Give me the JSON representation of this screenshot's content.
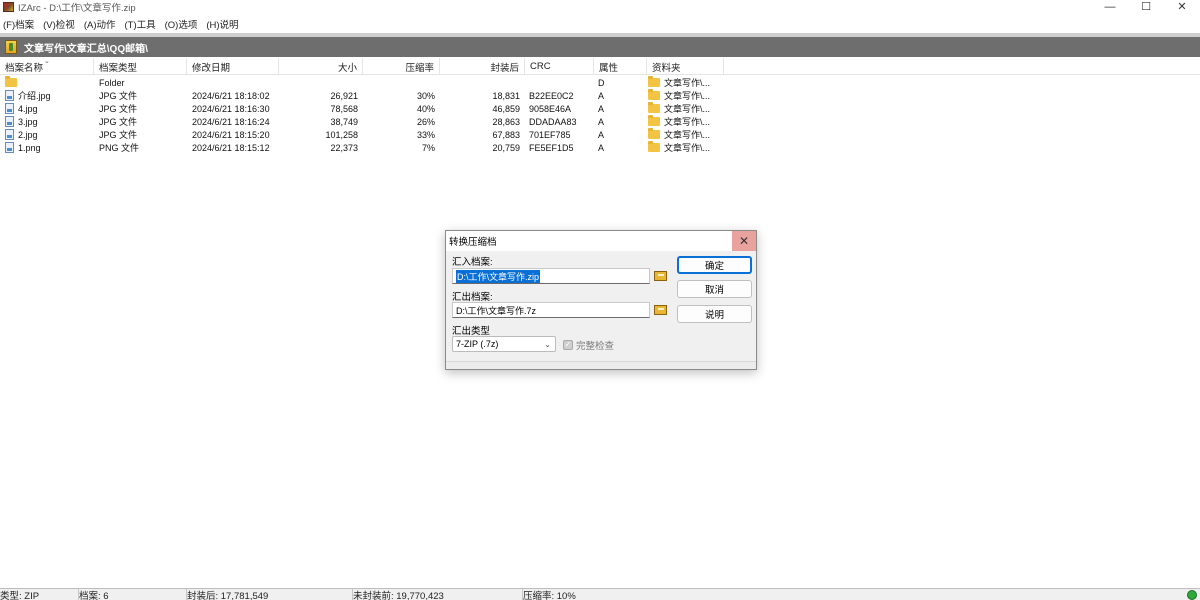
{
  "window": {
    "title": "IZArc - D:\\工作\\文章写作.zip",
    "minimize": "—",
    "maximize": "☐",
    "close": "✕"
  },
  "menu": [
    "(F)档案",
    "(V)检视",
    "(A)动作",
    "(T)工具",
    "(O)选项",
    "(H)说明"
  ],
  "path": "文章写作\\文章汇总\\QQ邮箱\\",
  "columns": {
    "name": "档案名称",
    "type": "档案类型",
    "modified": "修改日期",
    "size": "大小",
    "ratio": "压缩率",
    "packed": "封装后",
    "crc": "CRC",
    "attr": "属性",
    "folder": "资料夹"
  },
  "rows": [
    {
      "icon": "folder-icon",
      "name": "",
      "type": "Folder",
      "modified": "",
      "size": "",
      "ratio": "",
      "packed": "",
      "crc": "",
      "attr": "D",
      "folder": "文章写作\\..."
    },
    {
      "icon": "image-file-icon",
      "name": "介绍.jpg",
      "type": "JPG 文件",
      "modified": "2024/6/21 18:18:02",
      "size": "26,921",
      "ratio": "30%",
      "packed": "18,831",
      "crc": "B22EE0C2",
      "attr": "A",
      "folder": "文章写作\\..."
    },
    {
      "icon": "image-file-icon",
      "name": "4.jpg",
      "type": "JPG 文件",
      "modified": "2024/6/21 18:16:30",
      "size": "78,568",
      "ratio": "40%",
      "packed": "46,859",
      "crc": "9058E46A",
      "attr": "A",
      "folder": "文章写作\\..."
    },
    {
      "icon": "image-file-icon",
      "name": "3.jpg",
      "type": "JPG 文件",
      "modified": "2024/6/21 18:16:24",
      "size": "38,749",
      "ratio": "26%",
      "packed": "28,863",
      "crc": "DDADAA83",
      "attr": "A",
      "folder": "文章写作\\..."
    },
    {
      "icon": "image-file-icon",
      "name": "2.jpg",
      "type": "JPG 文件",
      "modified": "2024/6/21 18:15:20",
      "size": "101,258",
      "ratio": "33%",
      "packed": "67,883",
      "crc": "701EF785",
      "attr": "A",
      "folder": "文章写作\\..."
    },
    {
      "icon": "image-file-icon",
      "name": "1.png",
      "type": "PNG 文件",
      "modified": "2024/6/21 18:15:12",
      "size": "22,373",
      "ratio": "7%",
      "packed": "20,759",
      "crc": "FE5EF1D5",
      "attr": "A",
      "folder": "文章写作\\..."
    }
  ],
  "dialog": {
    "title": "转换压缩档",
    "input_label": "汇入档案:",
    "input_value": "D:\\工作\\文章写作.zip",
    "output_label": "汇出档案:",
    "output_value": "D:\\工作\\文章写作.7z",
    "type_label": "汇出类型",
    "type_value": "7-ZIP (.7z)",
    "check_label": "完整检查",
    "ok": "确定",
    "cancel": "取消",
    "help": "说明",
    "close": "✕"
  },
  "status": {
    "type": "类型: ZIP",
    "files": "档案: 6",
    "packed": "封装后: 17,781,549",
    "unpacked": "未封装前: 19,770,423",
    "ratio": "压缩率: 10%"
  },
  "colors": {
    "path_bar": "#6e6e6e",
    "selection": "#0a6fd6",
    "status_led": "#2fa83a"
  }
}
